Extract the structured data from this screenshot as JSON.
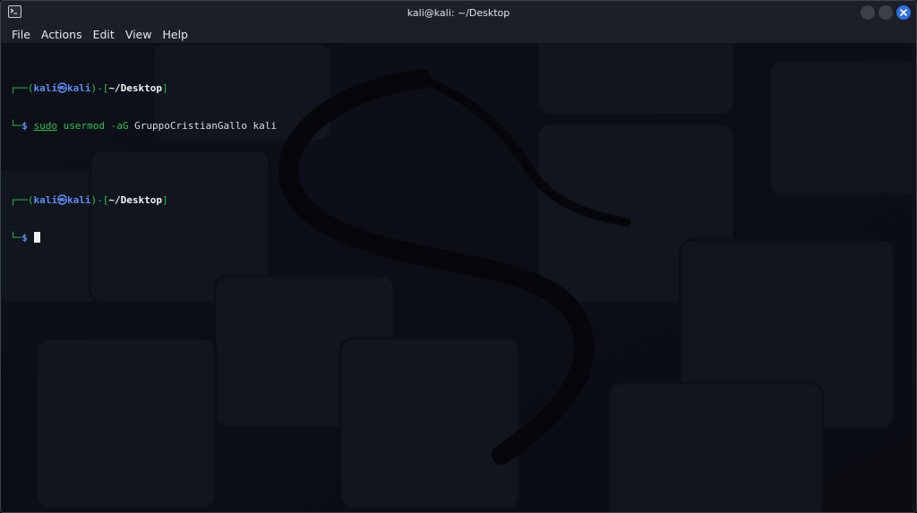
{
  "window": {
    "title": "kali@kali: ~/Desktop"
  },
  "menu": {
    "items": [
      "File",
      "Actions",
      "Edit",
      "View",
      "Help"
    ]
  },
  "terminal": {
    "prompt1": {
      "corner_top": "┌──(",
      "user": "kali",
      "at": "㉿",
      "host": "kali",
      "sep": ")-[",
      "path": "~/Desktop",
      "close": "]",
      "corner_bottom": "└─",
      "dollar": "$ ",
      "cmd": "sudo",
      "arg1": " usermod",
      "opt": " -aG",
      "args": " GruppoCristianGallo kali"
    },
    "prompt2": {
      "corner_top": "┌──(",
      "user": "kali",
      "at": "㉿",
      "host": "kali",
      "sep": ")-[",
      "path": "~/Desktop",
      "close": "]",
      "corner_bottom": "└─",
      "dollar": "$ "
    }
  },
  "icons": {
    "app": "terminal-icon",
    "minimize": "minimize-icon",
    "maximize": "maximize-icon",
    "close": "close-icon"
  },
  "colors": {
    "prompt_green": "#2bbf52",
    "prompt_blue": "#5f8cf2",
    "close_button": "#2f6fe0",
    "titlebar": "#1c1f26"
  }
}
